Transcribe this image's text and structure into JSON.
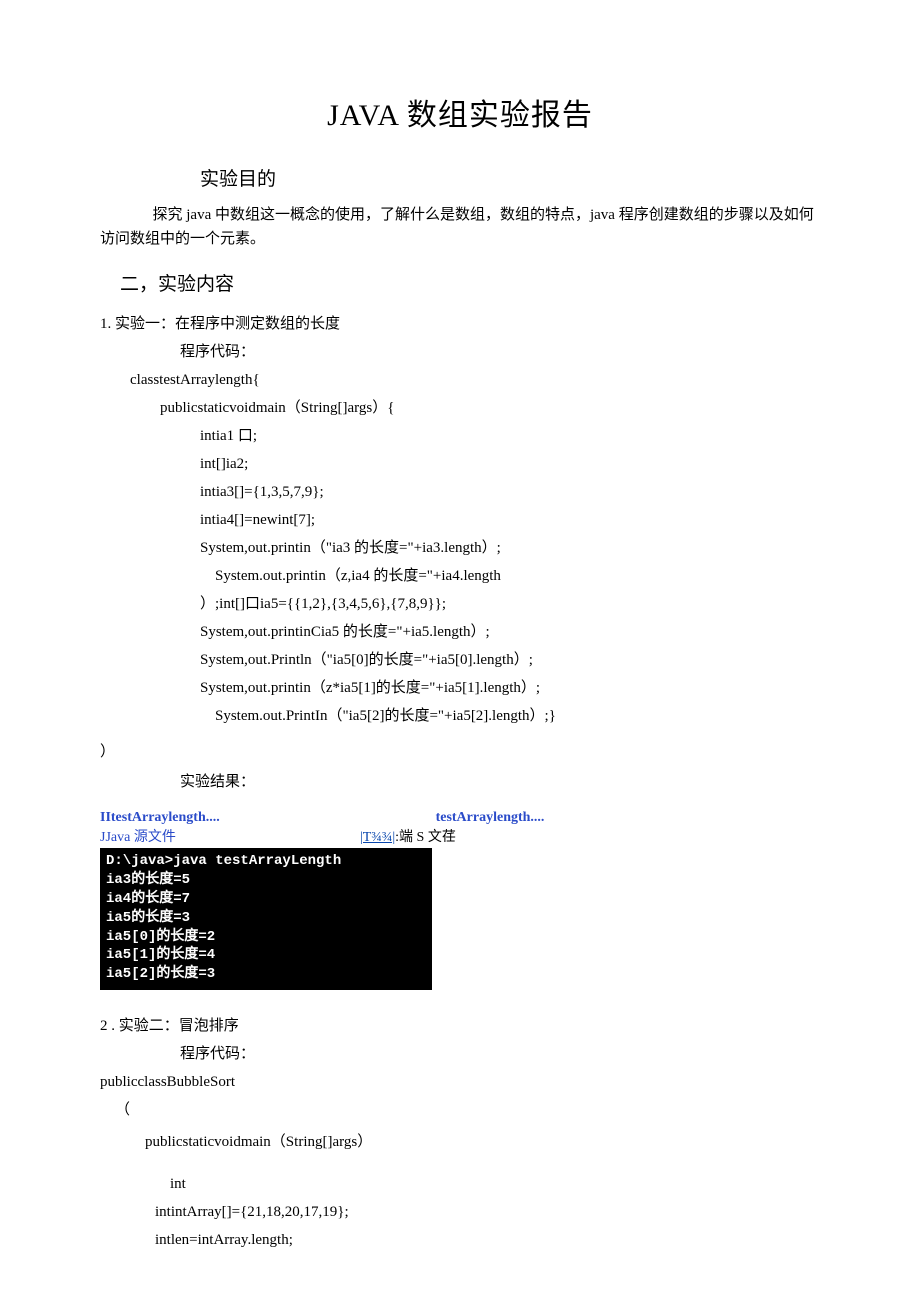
{
  "title": "JAVA 数组实验报告",
  "sections": {
    "purpose_heading": "实验目的",
    "purpose_text": "探究 java 中数组这一概念的使用，了解什么是数组，数组的特点，java 程序创建数组的步骤以及如何访问数组中的一个元素。",
    "content_heading": "二，实验内容"
  },
  "exp1": {
    "heading": "1. 实验一：在程序中测定数组的长度",
    "code_label": "程序代码：",
    "code": [
      "classtestArraylength{",
      "publicstaticvoidmain（String[]args）{",
      "intia1 口;",
      "int[]ia2;",
      "intia3[]={1,3,5,7,9};",
      "intia4[]=newint[7];",
      "System,out.printin（\"ia3 的长度=\"+ia3.length）;",
      "System.out.printin（z,ia4 的长度=\"+ia4.length",
      "）;int[]口ia5={{1,2},{3,4,5,6},{7,8,9}};",
      "System,out.printinCia5 的长度=\"+ia5.length）;",
      "System,out.Println（\"ia5[0]的长度=\"+ia5[0].length）;",
      "System,out.printin（z*ia5[1]的长度=\"+ia5[1].length）;",
      "System.out.PrintIn（\"ia5[2]的长度=\"+ia5[2].length）;}"
    ],
    "close_paren": "）",
    "result_label": "实验结果：",
    "file1_name": "IItestArraylength....",
    "file1_sub": "JJava 源文件",
    "file2_name": "testArraylength....",
    "file2_link": "|T¾¾|",
    "file2_suffix": ":端 S 文荏",
    "terminal": [
      "D:\\java>java testArrayLength",
      "ia3的长度=5",
      "ia4的长度=7",
      "ia5的长度=3",
      "ia5[0]的长度=2",
      "ia5[1]的长度=4",
      "ia5[2]的长度=3"
    ]
  },
  "exp2": {
    "heading": "2 . 实验二：冒泡排序",
    "code_label": "程序代码：",
    "code": [
      "publicclassBubbleSort",
      "（",
      "publicstaticvoidmain（String[]args）",
      "int",
      "intintArray[]={21,18,20,17,19};",
      "intlen=intArray.length;"
    ]
  }
}
